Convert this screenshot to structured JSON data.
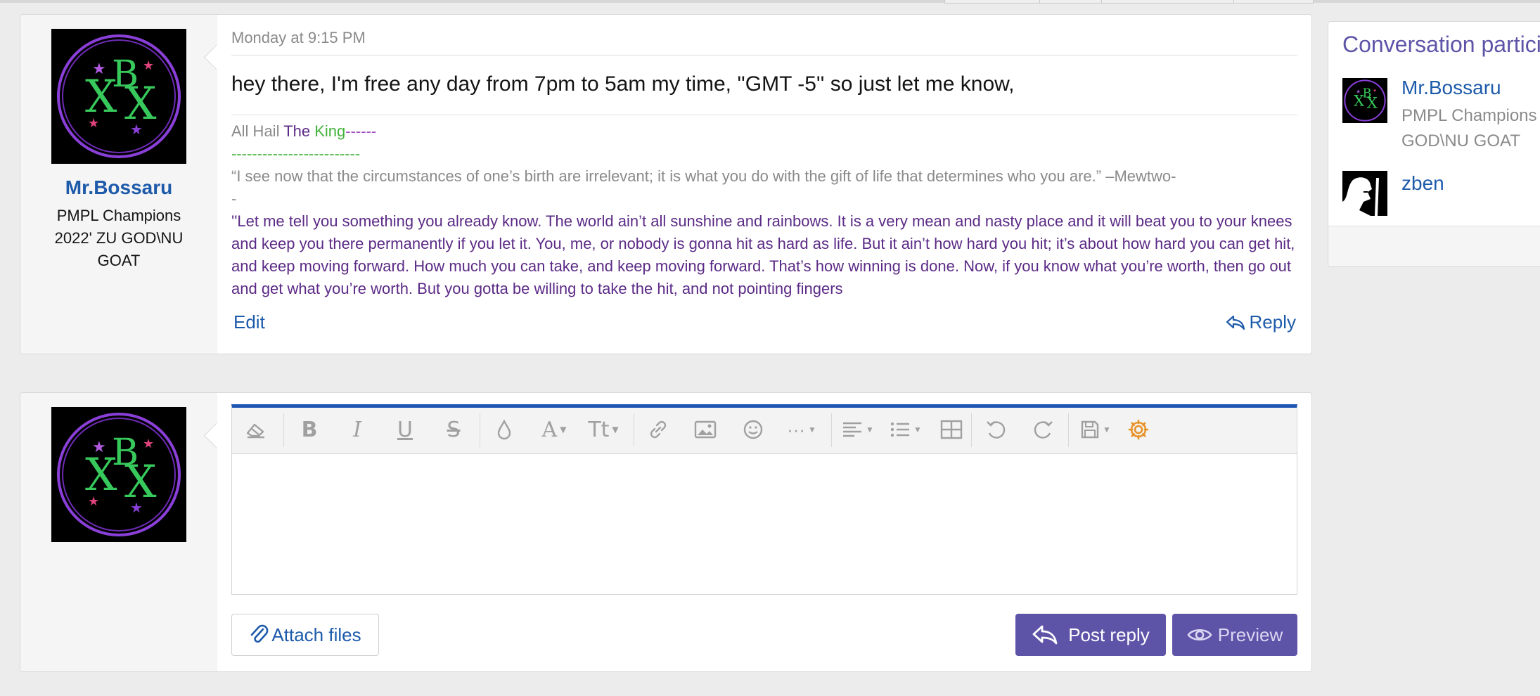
{
  "message": {
    "timestamp": "Monday at 9:15 PM",
    "author": {
      "name": "Mr.Bossaru",
      "title_lines": [
        "PMPL Champions",
        "2022' ZU GOD\\NU",
        "GOAT"
      ],
      "avatar_letters": "XBX"
    },
    "text": "hey there, I'm free any day from 7pm to 5am my time, ''GMT -5'' so just let me know,",
    "signature": {
      "line1": {
        "a": "All Hail ",
        "b": "The ",
        "c": "King",
        "d": "------"
      },
      "line2": "-------------------------",
      "quote1": "“I see now that the circumstances of one’s birth are irrelevant; it is what you do with the gift of life that determines who you are.” –Mewtwo-",
      "quote1_tail": "-",
      "quote2": "''Let me tell you something you already know. The world ain’t all sunshine and rainbows. It is a very mean and nasty place and it will beat you to your knees and keep you there permanently if you let it. You, me, or nobody is gonna hit as hard as life. But it ain’t how hard you hit; it’s about how hard you can get hit, and keep moving forward. How much you can take, and keep moving forward. That’s how winning is done. Now, if you know what you’re worth, then go out and get what you’re worth. But you gotta be willing to take the hit, and not pointing fingers"
    },
    "edit_label": "Edit",
    "reply_label": "Reply"
  },
  "composer": {
    "toolbar": [
      "clear-formatting",
      "bold",
      "italic",
      "underline",
      "strikethrough",
      "text-color",
      "font-family",
      "font-size",
      "insert-link",
      "insert-image",
      "smilies",
      "more-options",
      "align",
      "list",
      "insert-table",
      "undo",
      "redo",
      "drafts",
      "toggle-bbcode"
    ],
    "attach_label": "Attach files",
    "post_label": "Post reply",
    "preview_label": "Preview"
  },
  "sidebar": {
    "title": "Conversation participants",
    "participants": [
      {
        "name": "Mr.Bossaru",
        "title_lines": [
          "PMPL Champions",
          "GOD\\NU GOAT"
        ]
      },
      {
        "name": "zben"
      }
    ]
  },
  "colors": {
    "link": "#1d5aaa",
    "accent": "#1e56b4",
    "button": "#5d54a8",
    "settings_icon": "#e8932a"
  }
}
